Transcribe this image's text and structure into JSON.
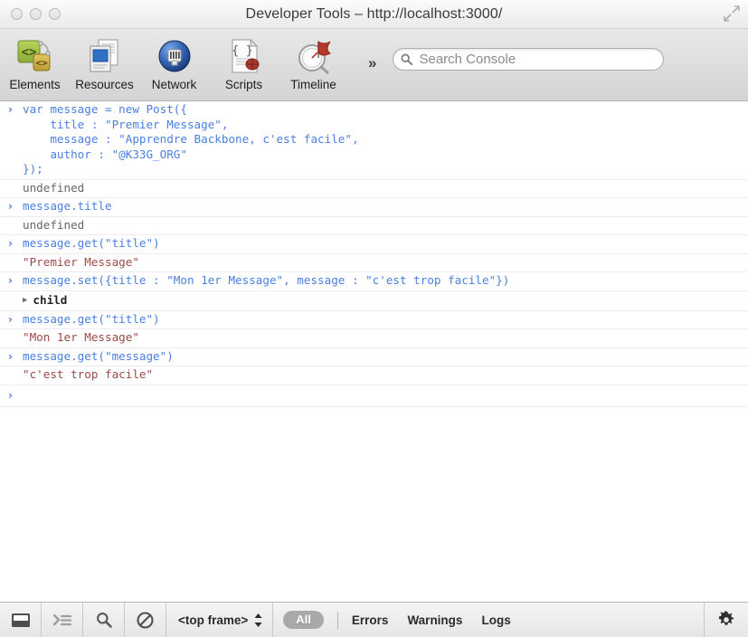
{
  "window": {
    "title": "Developer Tools – http://localhost:3000/",
    "traffic_lights": [
      "close",
      "minimize",
      "zoom"
    ],
    "fullscreen_icon": "fullscreen-arrows-icon"
  },
  "toolbar": {
    "tabs": [
      {
        "label": "Elements",
        "icon": "elements-icon"
      },
      {
        "label": "Resources",
        "icon": "resources-icon"
      },
      {
        "label": "Network",
        "icon": "network-icon"
      },
      {
        "label": "Scripts",
        "icon": "scripts-icon"
      },
      {
        "label": "Timeline",
        "icon": "timeline-icon"
      }
    ],
    "overflow_label": "»",
    "search": {
      "placeholder": "Search Console",
      "value": "",
      "icon": "search-icon"
    }
  },
  "console": {
    "prompt_symbol": "›",
    "entries": [
      {
        "type": "input",
        "lines": [
          "var message = new Post({",
          "    title : \"Premier Message\",",
          "    message : \"Apprendre Backbone, c'est facile\",",
          "    author : \"@K33G_ORG\"",
          "});"
        ]
      },
      {
        "type": "output",
        "value": "undefined",
        "style": "plain"
      },
      {
        "type": "input",
        "lines": [
          "message.title"
        ]
      },
      {
        "type": "output",
        "value": "undefined",
        "style": "plain"
      },
      {
        "type": "input",
        "lines": [
          "message.get(\"title\")"
        ]
      },
      {
        "type": "output",
        "value": "\"Premier Message\"",
        "style": "string"
      },
      {
        "type": "input",
        "lines": [
          "message.set({title : \"Mon 1er Message\", message : \"c'est trop facile\"})"
        ]
      },
      {
        "type": "object",
        "value": "child",
        "disclosure": "▶"
      },
      {
        "type": "input",
        "lines": [
          "message.get(\"title\")"
        ]
      },
      {
        "type": "output",
        "value": "\"Mon 1er Message\"",
        "style": "string"
      },
      {
        "type": "input",
        "lines": [
          "message.get(\"message\")"
        ]
      },
      {
        "type": "output",
        "value": "\"c'est trop facile\"",
        "style": "string"
      },
      {
        "type": "prompt"
      }
    ]
  },
  "statusbar": {
    "buttons": [
      {
        "name": "dock-console-icon",
        "title": "Dock to main window"
      },
      {
        "name": "console-prompt-icon",
        "title": "Show console"
      },
      {
        "name": "search-icon",
        "title": "Search"
      },
      {
        "name": "clear-console-icon",
        "title": "Clear console"
      }
    ],
    "frame_selector": {
      "label": "<top frame>",
      "icon": "updown-arrows-icon"
    },
    "filter_all": "All",
    "filters": [
      "Errors",
      "Warnings",
      "Logs"
    ],
    "gear_icon": "gear-icon"
  },
  "colors": {
    "input_text": "#4a7fe0",
    "result_text": "#666666",
    "string_text": "#9c4a46",
    "divider": "#ededed",
    "toolbar_bg": "#dedede",
    "pill_bg": "#a9a9a9"
  }
}
